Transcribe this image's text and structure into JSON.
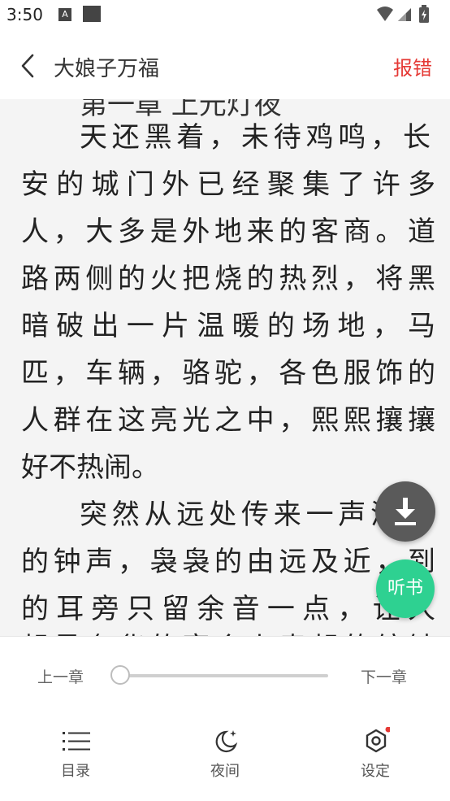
{
  "status_bar": {
    "time": "3:50",
    "a_icon_letter": "A"
  },
  "header": {
    "title": "大娘子万福",
    "report_label": "报错"
  },
  "reader": {
    "partial_heading": "第一章 上元灯夜",
    "lines": [
      "天还黑着，未待鸡鸣，长",
      "安的城门外已经聚集了许多",
      "人，大多是外地来的客商。道",
      "路两侧的火把烧的热烈，将黑",
      "暗破出一片温暖的场地，马",
      "匹，车辆，骆驼，各色服饰的",
      "人群在这亮光之中，熙熙攘攘",
      "好不热闹。",
      "突然从远处传来一声清脆",
      "的钟声，袅袅的由远及近，到",
      "的耳旁只留余音一点，让人",
      "起最奢华的宴会上奏起的编钟"
    ]
  },
  "fab": {
    "listen_label": "听书"
  },
  "chapter_nav": {
    "prev_label": "上一章",
    "next_label": "下一章",
    "progress": 0.0
  },
  "bottom_nav": {
    "items": [
      {
        "label": "目录",
        "icon": "list-icon"
      },
      {
        "label": "夜间",
        "icon": "moon-icon"
      },
      {
        "label": "设定",
        "icon": "gear-icon"
      }
    ]
  },
  "colors": {
    "accent_red": "#e53935",
    "listen_green": "#2ed191",
    "reader_bg": "#f4f4f4"
  }
}
